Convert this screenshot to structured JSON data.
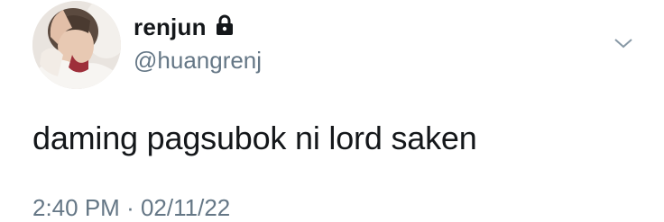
{
  "tweet": {
    "display_name": "renjun",
    "handle": "@huangrenj",
    "text": "daming pagsubok ni lord saken",
    "time": "2:40 PM",
    "separator": "·",
    "date": "02/11/22"
  },
  "icons": {
    "lock": "lock-icon",
    "menu": "chevron-down-icon"
  },
  "colors": {
    "text_primary": "#14171a",
    "text_secondary": "#657786",
    "background": "#ffffff"
  }
}
